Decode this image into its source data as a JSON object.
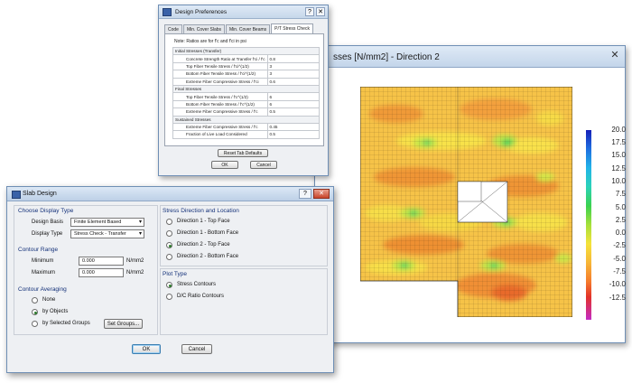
{
  "plot_window": {
    "title": "sses [N/mm2] - Direction 2",
    "legend": [
      "20.0",
      "17.5",
      "15.0",
      "12.5",
      "10.0",
      "7.5",
      "5.0",
      "2.5",
      "0.0",
      "-2.5",
      "-5.0",
      "-7.5",
      "-10.0",
      "-12.5"
    ]
  },
  "preferences": {
    "title": "Design Preferences",
    "tabs": [
      "Code",
      "Min. Cover Slabs",
      "Min. Cover Beams",
      "P/T Stress Check"
    ],
    "note": "Note:  Ratios are for f'c and f'ci in psi",
    "sections": [
      {
        "header": "Initial Stresses (Transfer)",
        "rows": [
          {
            "label": "Concrete Strength Ratio at Transfer f'ci / f'c",
            "value": "0.8"
          },
          {
            "label": "Top Fiber Tensile Stress / f'ci^(1/2)",
            "value": "3"
          },
          {
            "label": "Bottom Fiber Tensile Stress / f'ci^(1/2)",
            "value": "3"
          },
          {
            "label": "Extreme Fiber Compressive Stress / f'ci",
            "value": "0.6"
          }
        ]
      },
      {
        "header": "Final Stresses",
        "rows": [
          {
            "label": "Top Fiber Tensile Stress / f'c^(1/2)",
            "value": "6"
          },
          {
            "label": "Bottom Fiber Tensile Stress / f'c^(1/2)",
            "value": "6"
          },
          {
            "label": "Extreme Fiber Compressive Stress / f'c",
            "value": "0.5"
          }
        ]
      },
      {
        "header": "Sustained Stresses",
        "rows": [
          {
            "label": "Extreme Fiber Compressive Stress / f'c",
            "value": "0.45"
          },
          {
            "label": "Fraction of Live Load Considered",
            "value": "0.5"
          }
        ]
      }
    ],
    "reset_label": "Reset Tab Defaults",
    "ok_label": "OK",
    "cancel_label": "Cancel"
  },
  "slab_design": {
    "title": "Slab Design",
    "display_type": {
      "title": "Choose Display Type",
      "design_basis_label": "Design Basis",
      "design_basis_value": "Finite Element Based",
      "display_type_label": "Display Type",
      "display_type_value": "Stress Check - Transfer"
    },
    "contour_range": {
      "title": "Contour Range",
      "min_label": "Minimum",
      "min_value": "0.000",
      "max_label": "Maximum",
      "max_value": "0.000",
      "unit": "N/mm2"
    },
    "contour_averaging": {
      "title": "Contour Averaging",
      "options": [
        "None",
        "by Objects",
        "by Selected Groups"
      ],
      "selected": "by Objects",
      "set_groups_label": "Set Groups..."
    },
    "stress_direction": {
      "title": "Stress Direction and Location",
      "options": [
        "Direction 1  - Top Face",
        "Direction 1  - Bottom Face",
        "Direction 2  - Top Face",
        "Direction 2  - Bottom Face"
      ],
      "selected": "Direction 2  - Top Face"
    },
    "plot_type": {
      "title": "Plot Type",
      "options": [
        "Stress Contours",
        "D/C Ratio Contours"
      ],
      "selected": "Stress Contours"
    },
    "ok_label": "OK",
    "cancel_label": "Cancel"
  },
  "colors": {
    "title_blue": "#15327a",
    "contour_low": "#3bd24f",
    "contour_mid": "#f5e23a",
    "contour_high": "#f57a2c"
  }
}
